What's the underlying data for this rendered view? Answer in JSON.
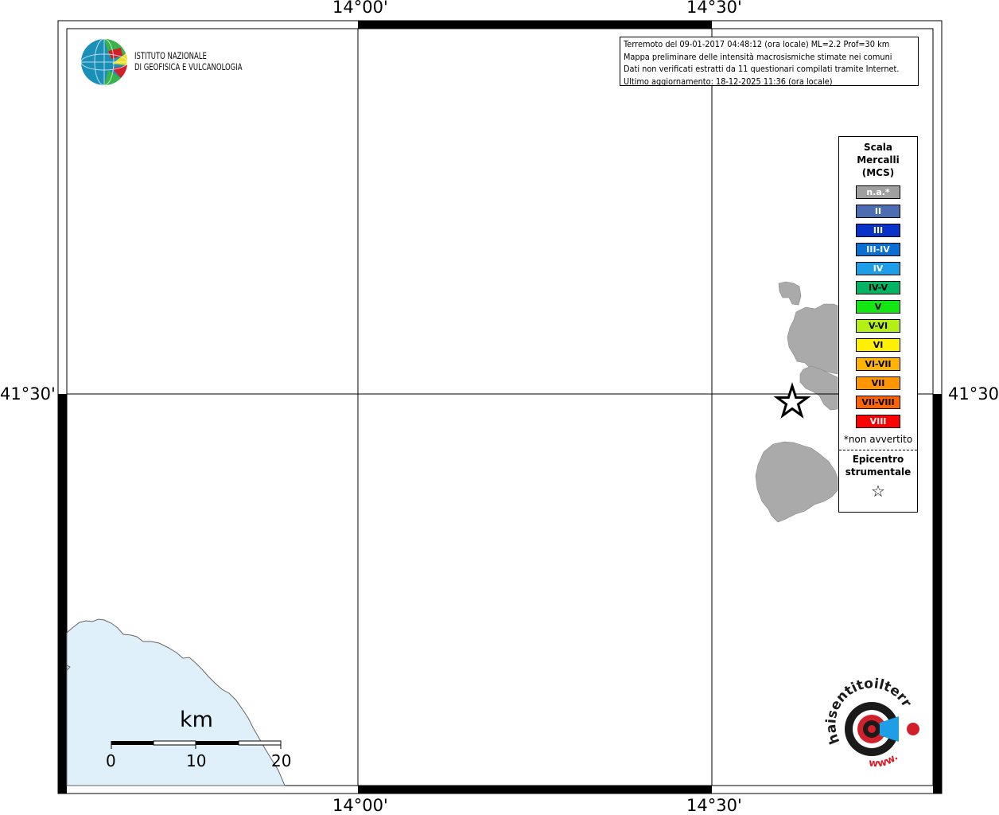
{
  "axis": {
    "top": [
      "14°00'",
      "14°30'"
    ],
    "bottom": [
      "14°00'",
      "14°30'"
    ],
    "left": "41°30'",
    "right": "41°30'"
  },
  "logo": {
    "line1": "ISTITUTO NAZIONALE",
    "line2": "DI GEOFISICA E VULCANOLOGIA"
  },
  "info": {
    "line1": "Terremoto del 09-01-2017 04:48:12 (ora locale) ML=2.2 Prof=30 km",
    "line2": "Mappa preliminare delle intensità macrosismiche stimate nei comuni",
    "line3": "Dati non verificati estratti da 11 questionari compilati tramite Internet.",
    "line4": "Ultimo aggiornamento: 18-12-2025 11:36 (ora locale)"
  },
  "legend": {
    "title": "Scala Mercalli (MCS)",
    "items": [
      {
        "label": "n.a.*",
        "color": "#a0a0a0"
      },
      {
        "label": "II",
        "color": "#4d6db3"
      },
      {
        "label": "III",
        "color": "#0a32c8"
      },
      {
        "label": "III-IV",
        "color": "#0a6ed2"
      },
      {
        "label": "IV",
        "color": "#1e9ee6"
      },
      {
        "label": "IV-V",
        "color": "#00b464"
      },
      {
        "label": "V",
        "color": "#14e614"
      },
      {
        "label": "V-VI",
        "color": "#b4f014"
      },
      {
        "label": "VI",
        "color": "#fff000"
      },
      {
        "label": "VI-VII",
        "color": "#ffb400"
      },
      {
        "label": "VII",
        "color": "#ff9600"
      },
      {
        "label": "VII-VIII",
        "color": "#ff6400"
      },
      {
        "label": "VIII",
        "color": "#ff0000"
      }
    ],
    "note": "*non avvertito",
    "epicenter_label": "Epicentro strumentale",
    "epicenter_symbol": "☆"
  },
  "scale": {
    "unit": "km",
    "labels": [
      "0",
      "10",
      "20"
    ]
  },
  "badge": {
    "top_text": "haisentitoilterremoto.it",
    "bottom_text": "www."
  }
}
